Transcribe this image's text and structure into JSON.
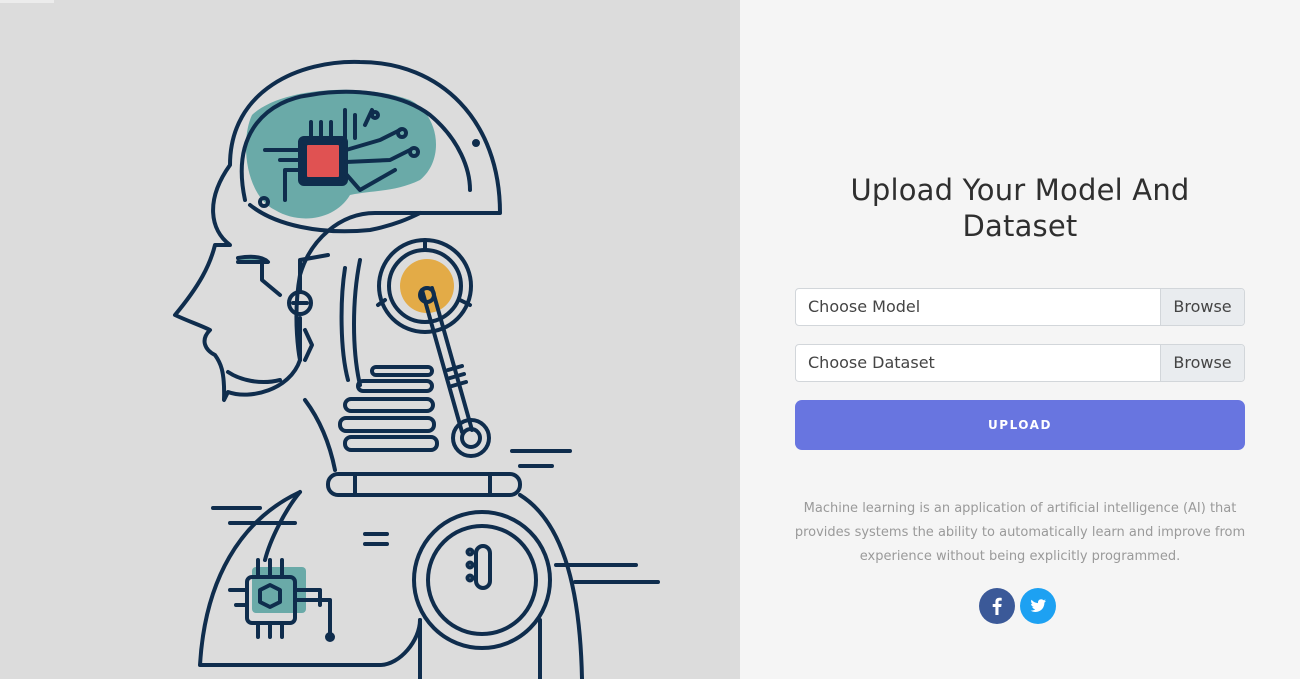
{
  "form": {
    "title": "Upload Your Model And Dataset",
    "model_input": {
      "label": "Choose Model",
      "browse_label": "Browse"
    },
    "dataset_input": {
      "label": "Choose Dataset",
      "browse_label": "Browse"
    },
    "upload_label": "UPLOAD"
  },
  "description": "Machine learning is an application of artificial intelligence (AI) that provides systems the ability to automatically learn and improve from experience without being explicitly programmed.",
  "social": [
    {
      "icon": "facebook-icon",
      "color": "#3b5998"
    },
    {
      "icon": "twitter-icon",
      "color": "#1da1f2"
    }
  ],
  "colors": {
    "left_background": "#dcdcdc",
    "right_background": "#f5f5f5",
    "accent": "#6875e0",
    "line_art": "#0f2d4d",
    "brain_fill": "#6aaaa8",
    "chip_red": "#e05252",
    "ear_gold": "#e3ab47"
  }
}
